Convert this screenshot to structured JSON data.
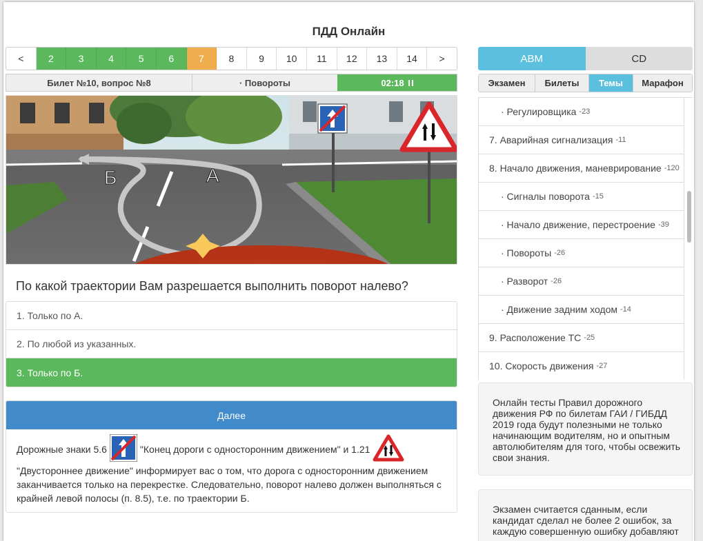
{
  "header": {
    "title": "ПДД Онлайн"
  },
  "pagination": {
    "prev_label": "<",
    "next_label": ">",
    "pages": [
      {
        "label": "2",
        "state": "answered"
      },
      {
        "label": "3",
        "state": "answered"
      },
      {
        "label": "4",
        "state": "answered"
      },
      {
        "label": "5",
        "state": "answered"
      },
      {
        "label": "6",
        "state": "answered"
      },
      {
        "label": "7",
        "state": "current"
      },
      {
        "label": "8",
        "state": "pending"
      },
      {
        "label": "9",
        "state": "pending"
      },
      {
        "label": "10",
        "state": "pending"
      },
      {
        "label": "11",
        "state": "pending"
      },
      {
        "label": "12",
        "state": "pending"
      },
      {
        "label": "13",
        "state": "pending"
      },
      {
        "label": "14",
        "state": "pending"
      }
    ]
  },
  "info_bar": {
    "ticket": "Билет №10, вопрос №8",
    "theme": "· Повороты",
    "timer": "02:18"
  },
  "scene": {
    "label_b": "Б",
    "label_a": "А"
  },
  "question": {
    "text": "По какой траектории Вам разрешается выполнить поворот налево?",
    "answers": [
      {
        "text": "1. Только по А.",
        "state": "normal"
      },
      {
        "text": "2. По любой из указанных.",
        "state": "normal"
      },
      {
        "text": "3. Только по Б.",
        "state": "correct"
      }
    ]
  },
  "explanation": {
    "next_label": "Далее",
    "part1": "Дорожные знаки 5.6",
    "part2": "\"Конец дороги с односторонним движением\" и 1.21",
    "line2": "\"Двустороннее движение\" информирует вас о том, что дорога с односторонним движением",
    "line3": "заканчивается только на перекрестке. Следовательно, поворот налево должен выполняться с",
    "line4": "крайней левой полосы (п. 8.5), т.е. по траектории Б."
  },
  "sidebar": {
    "categories": [
      {
        "label": "ABM",
        "active": true
      },
      {
        "label": "CD",
        "active": false
      }
    ],
    "modes": [
      {
        "label": "Экзамен",
        "active": false
      },
      {
        "label": "Билеты",
        "active": false
      },
      {
        "label": "Темы",
        "active": true
      },
      {
        "label": "Марафон",
        "active": false
      }
    ],
    "topics": [
      {
        "label": "· Регулировщика",
        "count": "-23",
        "sub": true
      },
      {
        "label": "7. Аварийная сигнализация",
        "count": "-11",
        "sub": false
      },
      {
        "label": "8. Начало движения, маневрирование",
        "count": "-120",
        "sub": false
      },
      {
        "label": "· Сигналы поворота",
        "count": "-15",
        "sub": true
      },
      {
        "label": "· Начало движение, перестроение",
        "count": "-39",
        "sub": true
      },
      {
        "label": "· Повороты",
        "count": "-26",
        "sub": true
      },
      {
        "label": "· Разворот",
        "count": "-26",
        "sub": true
      },
      {
        "label": "· Движение задним ходом",
        "count": "-14",
        "sub": true
      },
      {
        "label": "9. Расположение ТС",
        "count": "-25",
        "sub": false
      },
      {
        "label": "10. Скорость движения",
        "count": "-27",
        "sub": false
      }
    ],
    "info1": "Онлайн тесты Правил дорожного движения РФ по билетам ГАИ / ГИБДД 2019 года будут полезными не только начинающим водителям, но и опытным автолюбителям для того, чтобы освежить свои знания.",
    "info2": "Экзамен считается сданным, если кандидат сделал не более 2 ошибок, за каждую совершенную ошибку добавляют"
  },
  "colors": {
    "answered": "#5cb85c",
    "current": "#f0ad4e",
    "primary": "#428bca",
    "info": "#5bc0de"
  }
}
